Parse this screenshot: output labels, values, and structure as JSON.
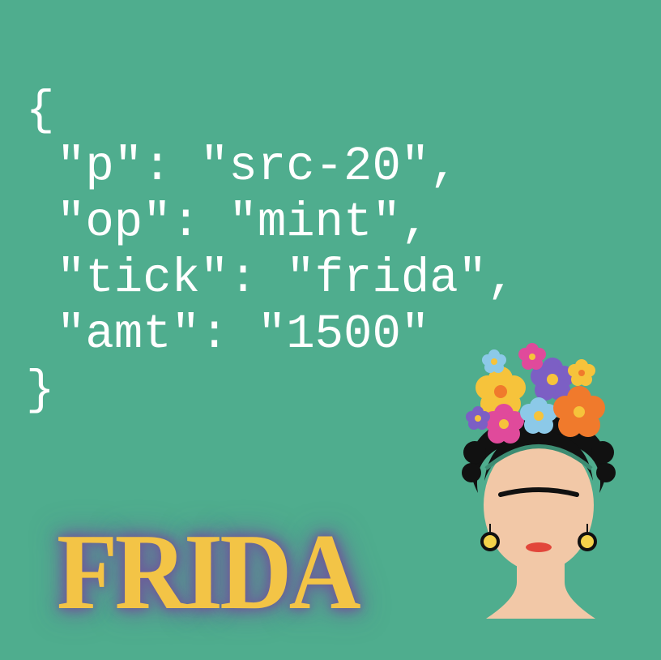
{
  "code_lines": [
    "{",
    "\"p\": \"src-20\",",
    "\"op\": \"mint\",",
    "\"tick\": \"frida\",",
    "\"amt\": \"1500\"",
    "}"
  ],
  "title": "FRIDA",
  "colors": {
    "background": "#4fad8e",
    "code_text": "#ffffff",
    "title_fill": "#f3c446",
    "title_glow": "#6c5f9a",
    "skin": "#f2c8a7",
    "hair": "#111111",
    "lips": "#e2463a",
    "flower_yellow": "#f6c33b",
    "flower_purple": "#7c5fc4",
    "flower_pink": "#e04a9b",
    "flower_orange": "#f07a2c",
    "flower_blue": "#8cc9e8",
    "earring": "#f4d24a"
  },
  "illustration": {
    "subject": "woman-with-flower-crown",
    "flower_count": 9
  }
}
